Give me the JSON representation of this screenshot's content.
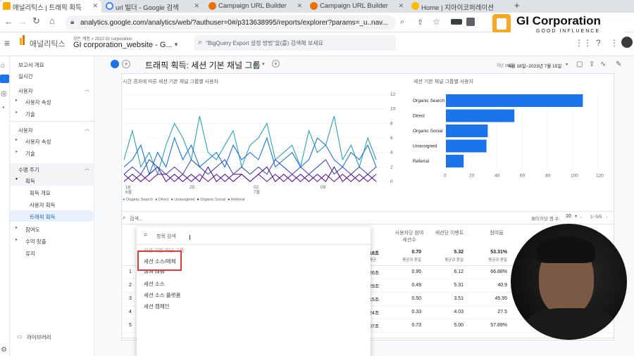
{
  "tabs": [
    {
      "label": "애널리틱스 | 트래픽 획득",
      "icon": "analytics-icon",
      "active": true
    },
    {
      "label": "url 빌더 - Google 검색",
      "icon": "google-icon",
      "active": false
    },
    {
      "label": "Campaign URL Builder",
      "icon": "builder-icon",
      "active": false
    },
    {
      "label": "Campaign URL Builder",
      "icon": "builder-icon",
      "active": false
    },
    {
      "label": "Home | 지아이코퍼레이션",
      "icon": "home-icon",
      "active": false
    }
  ],
  "new_tab": "+",
  "address": {
    "url": "analytics.google.com/analytics/web/?authuser=0#/p313638995/reports/explorer?params=_u..nav..."
  },
  "header": {
    "app_name": "애널리틱스",
    "breadcrumb": "모든 계정 > 2022 GI corporation",
    "property": "GI corporation_website - G...",
    "search_placeholder": "\"BigQuery Export 설정 방법\"을(를) 검색해 보세요"
  },
  "logo": {
    "brand": "GI Corporation",
    "tagline": "GOOD INFLUENCE"
  },
  "sidebar": {
    "items": [
      {
        "label": "보고서 개요",
        "type": "nav"
      },
      {
        "label": "실시간",
        "type": "nav"
      },
      {
        "label": "사용자",
        "type": "grp"
      },
      {
        "label": "사용자 속성",
        "type": "sub"
      },
      {
        "label": "기술",
        "type": "sub"
      },
      {
        "label": "사용자",
        "type": "grp"
      },
      {
        "label": "사용자 속성",
        "type": "sub"
      },
      {
        "label": "기술",
        "type": "sub"
      },
      {
        "label": "수명 주기",
        "type": "grp"
      },
      {
        "label": "획득",
        "type": "sub"
      },
      {
        "label": "획득 개요",
        "type": "sub2"
      },
      {
        "label": "사용자 획득",
        "type": "sub2"
      },
      {
        "label": "트래픽 획득",
        "type": "sub2",
        "selected": true
      },
      {
        "label": "참여도",
        "type": "sub"
      },
      {
        "label": "수익 창출",
        "type": "sub"
      },
      {
        "label": "유지",
        "type": "sub"
      }
    ],
    "library": "라이브러리"
  },
  "report": {
    "title": "트래픽 획득: 세션 기본 채널 그룹",
    "date_label": "지난 28일",
    "date_range": "6월 18일~2023년 7월 15일"
  },
  "line_chart": {
    "title": "시간 경과에 따른 세션 기본 채널 그룹별 사용자",
    "x_ticks": [
      "18\n6월",
      "25",
      "02\n7월",
      "09"
    ],
    "y_ticks": [
      "12",
      "10",
      "8",
      "6",
      "4",
      "2",
      "0"
    ],
    "legend": [
      "Organic Search",
      "Direct",
      "Unassigned",
      "Organic Social",
      "Referral"
    ],
    "colors": [
      "#2aa2b9",
      "#1a73e8",
      "#3f51b5",
      "#4a148c",
      "#6a1b9a"
    ]
  },
  "bar_chart": {
    "title": "세션 기본 채널 그룹별 사용자",
    "categories": [
      "Organic Search",
      "Direct",
      "Organic Social",
      "Unassigned",
      "Referral"
    ],
    "values": [
      108,
      54,
      33,
      32,
      14
    ],
    "x_ticks": [
      "0",
      "20",
      "40",
      "60",
      "80",
      "100",
      "120"
    ],
    "xlim": [
      0,
      120
    ],
    "color": "#1a73e8"
  },
  "table": {
    "search_placeholder": "검색...",
    "rows_per_page_label": "페이지당 행 수:",
    "rows_per_page": "10",
    "pagination": "1~5/5",
    "headers": [
      "사용자당 참여 세션수",
      "세션당 이벤트",
      "참여율"
    ],
    "totals": [
      {
        "value": "0.70",
        "sub": "평균과 동일"
      },
      {
        "value": "5.32",
        "sub": "평균과 동일"
      },
      {
        "value": "53.31%",
        "sub": "평균과 동일"
      }
    ],
    "left_totals": [
      "18초",
      "평균"
    ],
    "rows": [
      {
        "idx": "1",
        "dur": "26초",
        "c1": "0.95",
        "c2": "6.12",
        "c3": "66.88%"
      },
      {
        "idx": "2",
        "dur": "29초",
        "c1": "0.49",
        "c2": "5.31",
        "c3": "40.9"
      },
      {
        "idx": "3",
        "dur": "15초",
        "c1": "0.50",
        "c2": "3.51",
        "c3": "45.95"
      },
      {
        "idx": "4",
        "dur": "24초",
        "c1": "0.33",
        "c2": "4.03",
        "c3": "27.5"
      },
      {
        "idx": "5",
        "dur": "07초",
        "c1": "0.73",
        "c2": "5.00",
        "c3": "57.89%"
      }
    ]
  },
  "dropdown": {
    "search_placeholder": "항목 검색",
    "items": [
      "세션 기본 채널 그룹",
      "세션 소스/매체",
      "세션 매체",
      "세션 소스",
      "세션 소스 플랫폼",
      "세션 캠페인"
    ]
  }
}
